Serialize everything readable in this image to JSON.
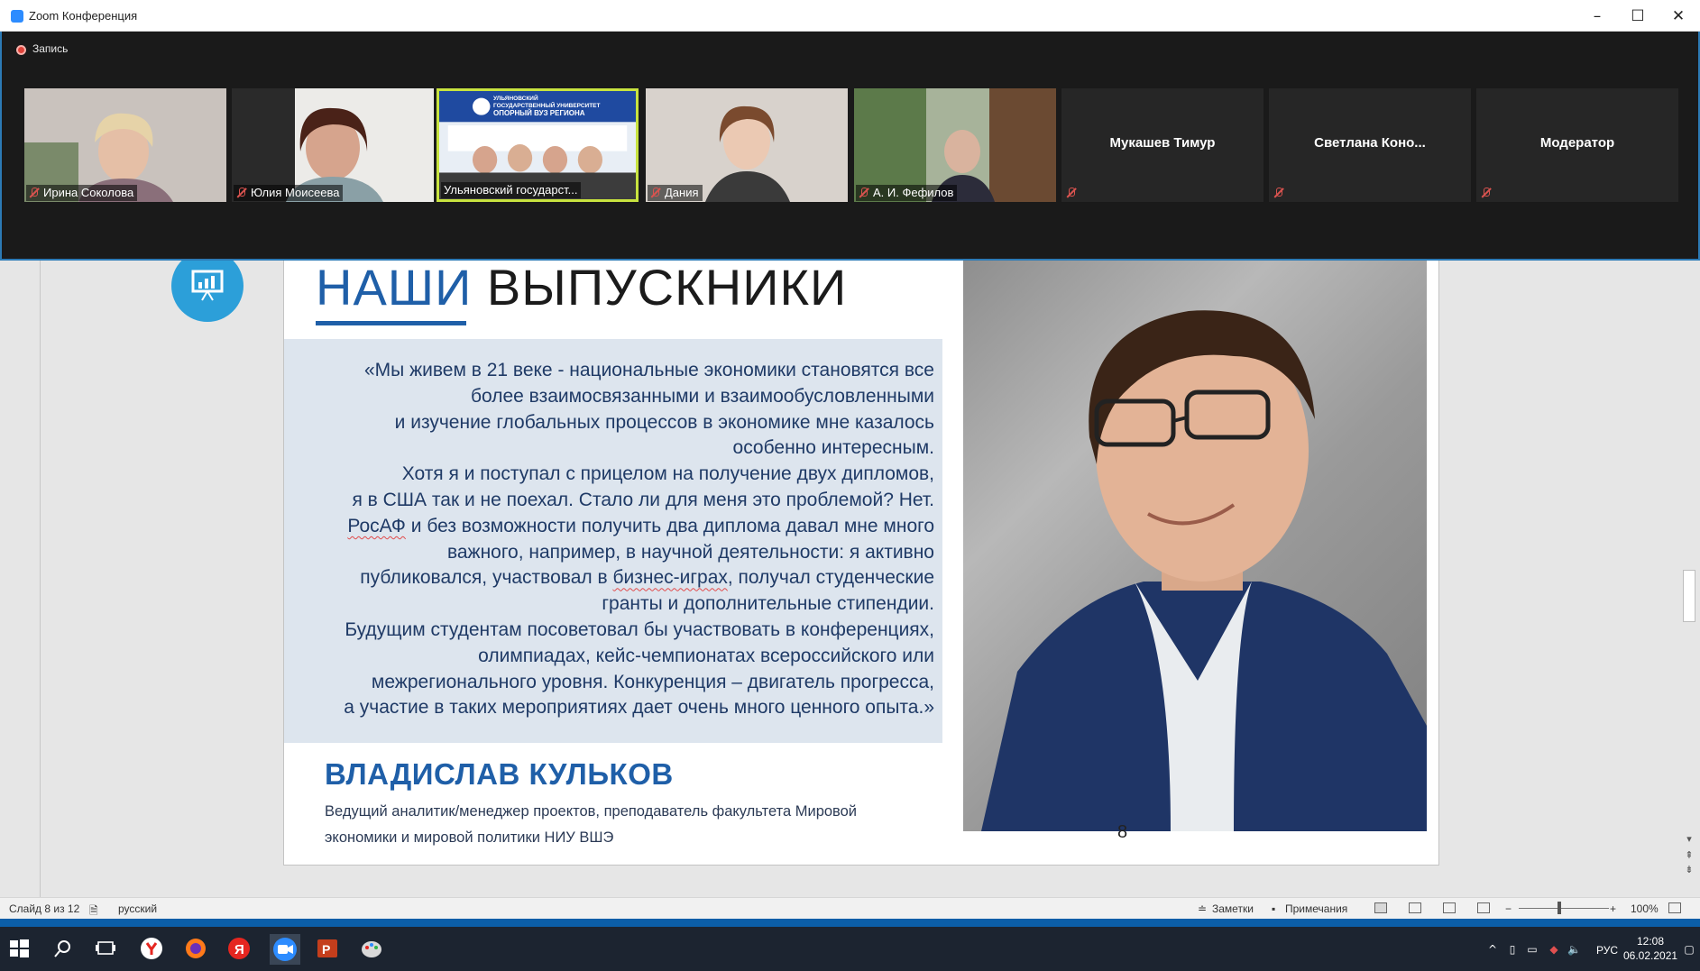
{
  "zoom": {
    "window_title": "Zoom Конференция",
    "recording_label": "Запись",
    "participants": [
      {
        "name": "Ирина Соколова",
        "video": true
      },
      {
        "name": "Юлия Моисеева",
        "video": true
      },
      {
        "name": "Ульяновский государст...",
        "video": true,
        "active_speaker": true
      },
      {
        "name": "Дания",
        "video": true
      },
      {
        "name": "А. И. Фефилов",
        "video": true
      },
      {
        "name": "Мукашев Тимур",
        "video": false
      },
      {
        "name": "Светлана  Коно...",
        "video": false
      },
      {
        "name": "Модератор",
        "video": false
      }
    ],
    "banner_text": [
      "УЛЬЯНОВСКИЙ",
      "ГОСУДАРСТВЕННЫЙ УНИВЕРСИТЕТ",
      "ОПОРНЫЙ ВУЗ РЕГИОНА"
    ]
  },
  "slide": {
    "title_accent": "НАШИ",
    "title_rest": " ВЫПУСКНИКИ",
    "quote_lines": [
      "«Мы  живем в 21 веке - национальные экономики становятся все",
      "более взаимосвязанными и взаимообусловленными",
      "и изучение глобальных процессов в экономике мне казалось",
      "особенно интересным.",
      "Хотя я и поступал с прицелом на получение двух дипломов,",
      "я в США так и не поехал. Стало ли для меня это проблемой? Нет.",
      "и без возможности получить два диплома давал мне много",
      "важного, например, в научной деятельности: я активно",
      "публиковался, участвовал в ",
      ", получал студенческие",
      "гранты и дополнительные стипендии.",
      "Будущим студентам посоветовал бы участвовать в конференциях,",
      "олимпиадах, кейс-чемпионатах всероссийского или",
      "межрегионального уровня. Конкуренция – двигатель прогресса,",
      "а участие в таких мероприятиях дает очень много ценного опыта.»"
    ],
    "quote_word_rosaf": "РосАФ",
    "quote_word_bizgames": "бизнес-играх",
    "person_name": "ВЛАДИСЛАВ КУЛЬКОВ",
    "person_role": "Ведущий аналитик/менеджер проектов, преподаватель факультета Мировой экономики и мировой политики НИУ ВШЭ",
    "slide_number": "8"
  },
  "statusbar": {
    "slide_counter": "Слайд 8 из 12",
    "language": "русский",
    "notes": "Заметки",
    "comments": "Примечания",
    "zoom_level": "100%",
    "zoom_minus": "−",
    "zoom_plus": "+"
  },
  "taskbar": {
    "lang": "РУС",
    "time": "12:08",
    "date": "06.02.2021"
  },
  "colors": {
    "accent_blue": "#1f5fa8",
    "zoom_blue": "#2d8cff",
    "muted_mic": "#d9534f",
    "active_speaker": "#c8e33f"
  }
}
